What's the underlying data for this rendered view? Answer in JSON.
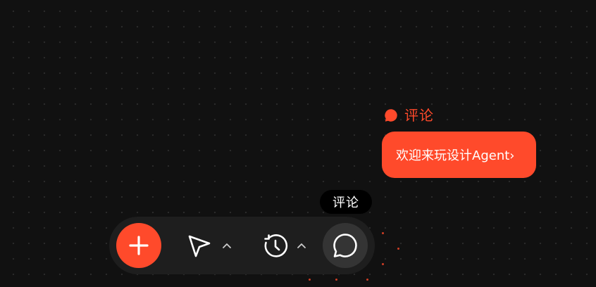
{
  "canvas": {
    "background": "#111111",
    "dot_color": "#2b2b2b"
  },
  "comment": {
    "label": "评论",
    "icon": "comment-bubble-icon",
    "message": "欢迎来玩设计Agent›",
    "accent": "#ff4a2b"
  },
  "tooltip": {
    "text": "评论"
  },
  "toolbar": {
    "add_icon": "plus-icon",
    "select_icon": "cursor-pointer-icon",
    "history_icon": "history-clock-icon",
    "chevron_icon": "chevron-up-icon",
    "comment_icon": "chat-bubble-icon",
    "active_tool": "comment",
    "accent": "#ff4a2b"
  }
}
